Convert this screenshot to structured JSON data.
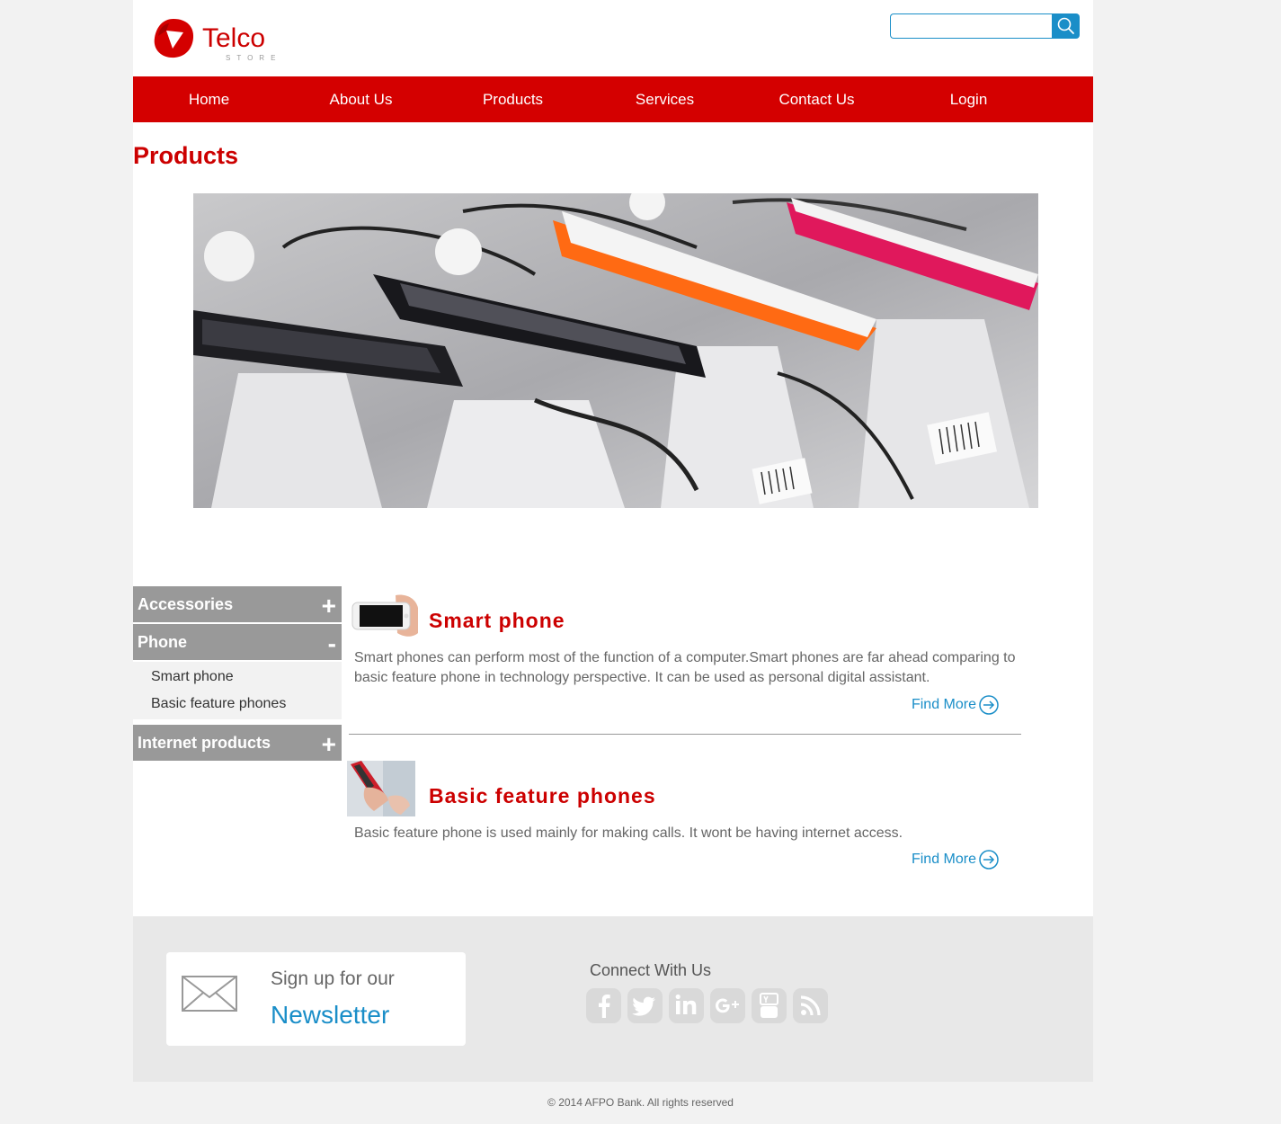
{
  "brand": {
    "name": "Telco",
    "tagline": "STORE",
    "color": "#cc0000"
  },
  "search": {
    "value": "",
    "placeholder": "",
    "icon": "search-icon"
  },
  "nav": {
    "items": [
      {
        "label": "Home"
      },
      {
        "label": "About Us"
      },
      {
        "label": "Products"
      },
      {
        "label": "Services"
      },
      {
        "label": "Contact Us"
      },
      {
        "label": "Login"
      }
    ]
  },
  "page": {
    "title": "Products"
  },
  "sidebar": {
    "sections": [
      {
        "label": "Accessories",
        "toggle": "+"
      },
      {
        "label": "Phone",
        "toggle": "-",
        "items": [
          "Smart phone",
          "Basic feature phones"
        ]
      },
      {
        "label": "Internet products",
        "toggle": "+"
      }
    ]
  },
  "products": [
    {
      "title": "Smart phone",
      "description": "Smart phones can perform most of the function of a computer.Smart phones are far ahead comparing to basic feature phone in technology perspective. It can be used as personal digital assistant.",
      "link": "Find More"
    },
    {
      "title": "Basic feature phones",
      "description": "Basic feature phone is used mainly for making calls. It wont be having internet access.",
      "link": "Find More"
    }
  ],
  "footer": {
    "newsletter_line1": "Sign up for our",
    "newsletter_line2": "Newsletter",
    "connect_label": "Connect With Us",
    "social_icons": [
      "facebook-icon",
      "twitter-icon",
      "linkedin-icon",
      "google-plus-icon",
      "youtube-icon",
      "rss-icon"
    ],
    "copyright": "© 2014 AFPO Bank. All rights reserved"
  },
  "colors": {
    "accent_red": "#d40000",
    "link_blue": "#1a8ec8",
    "sidebar_gray": "#999999"
  }
}
